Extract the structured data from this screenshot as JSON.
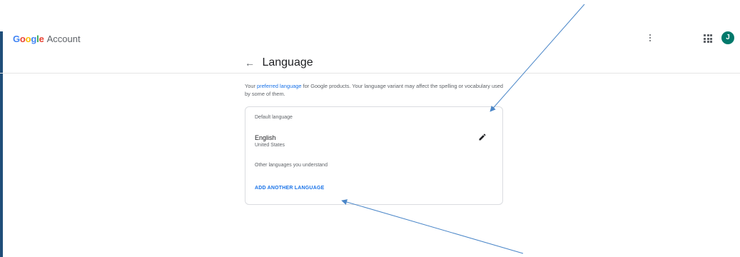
{
  "header": {
    "brand_google": "Google",
    "brand_account": "Account",
    "avatar_initial": "J"
  },
  "page": {
    "back_arrow": "←",
    "title": "Language",
    "intro_before": "Your ",
    "intro_link": "preferred language",
    "intro_after": " for Google products. Your language variant may affect the spelling or vocabulary used by some of them."
  },
  "card": {
    "default_label": "Default language",
    "language_name": "English",
    "language_region": "United States",
    "other_label": "Other languages you understand",
    "add_button": "ADD ANOTHER LANGUAGE"
  },
  "colors": {
    "accent": "#1a73e8",
    "annotation_arrow": "#4a86c8",
    "avatar": "#00796b",
    "left_rule": "#1f4e79"
  },
  "icons": [
    "back-arrow-icon",
    "more-vert-icon",
    "apps-grid-icon",
    "edit-pencil-icon"
  ]
}
